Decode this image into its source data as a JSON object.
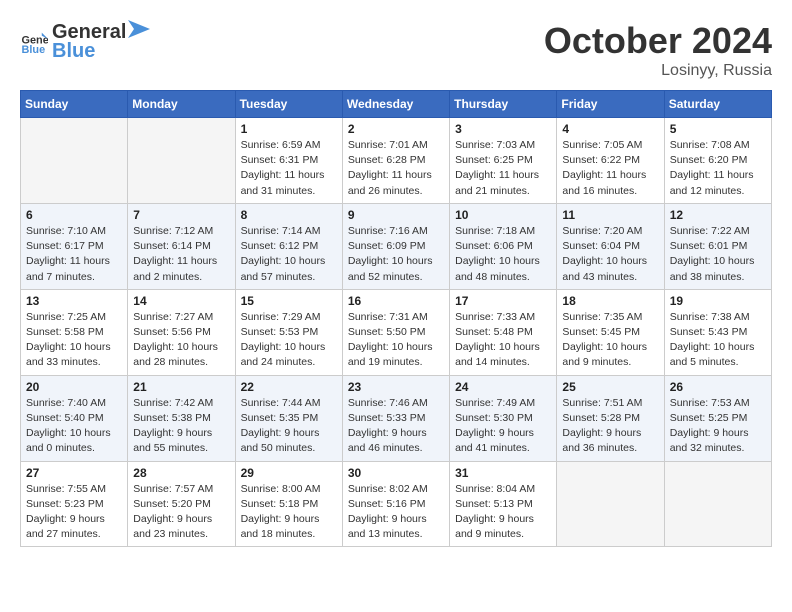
{
  "logo": {
    "general": "General",
    "blue": "Blue"
  },
  "title": "October 2024",
  "location": "Losinyy, Russia",
  "days_header": [
    "Sunday",
    "Monday",
    "Tuesday",
    "Wednesday",
    "Thursday",
    "Friday",
    "Saturday"
  ],
  "weeks": [
    [
      {
        "day": "",
        "info": ""
      },
      {
        "day": "",
        "info": ""
      },
      {
        "day": "1",
        "info": "Sunrise: 6:59 AM\nSunset: 6:31 PM\nDaylight: 11 hours and 31 minutes."
      },
      {
        "day": "2",
        "info": "Sunrise: 7:01 AM\nSunset: 6:28 PM\nDaylight: 11 hours and 26 minutes."
      },
      {
        "day": "3",
        "info": "Sunrise: 7:03 AM\nSunset: 6:25 PM\nDaylight: 11 hours and 21 minutes."
      },
      {
        "day": "4",
        "info": "Sunrise: 7:05 AM\nSunset: 6:22 PM\nDaylight: 11 hours and 16 minutes."
      },
      {
        "day": "5",
        "info": "Sunrise: 7:08 AM\nSunset: 6:20 PM\nDaylight: 11 hours and 12 minutes."
      }
    ],
    [
      {
        "day": "6",
        "info": "Sunrise: 7:10 AM\nSunset: 6:17 PM\nDaylight: 11 hours and 7 minutes."
      },
      {
        "day": "7",
        "info": "Sunrise: 7:12 AM\nSunset: 6:14 PM\nDaylight: 11 hours and 2 minutes."
      },
      {
        "day": "8",
        "info": "Sunrise: 7:14 AM\nSunset: 6:12 PM\nDaylight: 10 hours and 57 minutes."
      },
      {
        "day": "9",
        "info": "Sunrise: 7:16 AM\nSunset: 6:09 PM\nDaylight: 10 hours and 52 minutes."
      },
      {
        "day": "10",
        "info": "Sunrise: 7:18 AM\nSunset: 6:06 PM\nDaylight: 10 hours and 48 minutes."
      },
      {
        "day": "11",
        "info": "Sunrise: 7:20 AM\nSunset: 6:04 PM\nDaylight: 10 hours and 43 minutes."
      },
      {
        "day": "12",
        "info": "Sunrise: 7:22 AM\nSunset: 6:01 PM\nDaylight: 10 hours and 38 minutes."
      }
    ],
    [
      {
        "day": "13",
        "info": "Sunrise: 7:25 AM\nSunset: 5:58 PM\nDaylight: 10 hours and 33 minutes."
      },
      {
        "day": "14",
        "info": "Sunrise: 7:27 AM\nSunset: 5:56 PM\nDaylight: 10 hours and 28 minutes."
      },
      {
        "day": "15",
        "info": "Sunrise: 7:29 AM\nSunset: 5:53 PM\nDaylight: 10 hours and 24 minutes."
      },
      {
        "day": "16",
        "info": "Sunrise: 7:31 AM\nSunset: 5:50 PM\nDaylight: 10 hours and 19 minutes."
      },
      {
        "day": "17",
        "info": "Sunrise: 7:33 AM\nSunset: 5:48 PM\nDaylight: 10 hours and 14 minutes."
      },
      {
        "day": "18",
        "info": "Sunrise: 7:35 AM\nSunset: 5:45 PM\nDaylight: 10 hours and 9 minutes."
      },
      {
        "day": "19",
        "info": "Sunrise: 7:38 AM\nSunset: 5:43 PM\nDaylight: 10 hours and 5 minutes."
      }
    ],
    [
      {
        "day": "20",
        "info": "Sunrise: 7:40 AM\nSunset: 5:40 PM\nDaylight: 10 hours and 0 minutes."
      },
      {
        "day": "21",
        "info": "Sunrise: 7:42 AM\nSunset: 5:38 PM\nDaylight: 9 hours and 55 minutes."
      },
      {
        "day": "22",
        "info": "Sunrise: 7:44 AM\nSunset: 5:35 PM\nDaylight: 9 hours and 50 minutes."
      },
      {
        "day": "23",
        "info": "Sunrise: 7:46 AM\nSunset: 5:33 PM\nDaylight: 9 hours and 46 minutes."
      },
      {
        "day": "24",
        "info": "Sunrise: 7:49 AM\nSunset: 5:30 PM\nDaylight: 9 hours and 41 minutes."
      },
      {
        "day": "25",
        "info": "Sunrise: 7:51 AM\nSunset: 5:28 PM\nDaylight: 9 hours and 36 minutes."
      },
      {
        "day": "26",
        "info": "Sunrise: 7:53 AM\nSunset: 5:25 PM\nDaylight: 9 hours and 32 minutes."
      }
    ],
    [
      {
        "day": "27",
        "info": "Sunrise: 7:55 AM\nSunset: 5:23 PM\nDaylight: 9 hours and 27 minutes."
      },
      {
        "day": "28",
        "info": "Sunrise: 7:57 AM\nSunset: 5:20 PM\nDaylight: 9 hours and 23 minutes."
      },
      {
        "day": "29",
        "info": "Sunrise: 8:00 AM\nSunset: 5:18 PM\nDaylight: 9 hours and 18 minutes."
      },
      {
        "day": "30",
        "info": "Sunrise: 8:02 AM\nSunset: 5:16 PM\nDaylight: 9 hours and 13 minutes."
      },
      {
        "day": "31",
        "info": "Sunrise: 8:04 AM\nSunset: 5:13 PM\nDaylight: 9 hours and 9 minutes."
      },
      {
        "day": "",
        "info": ""
      },
      {
        "day": "",
        "info": ""
      }
    ]
  ]
}
